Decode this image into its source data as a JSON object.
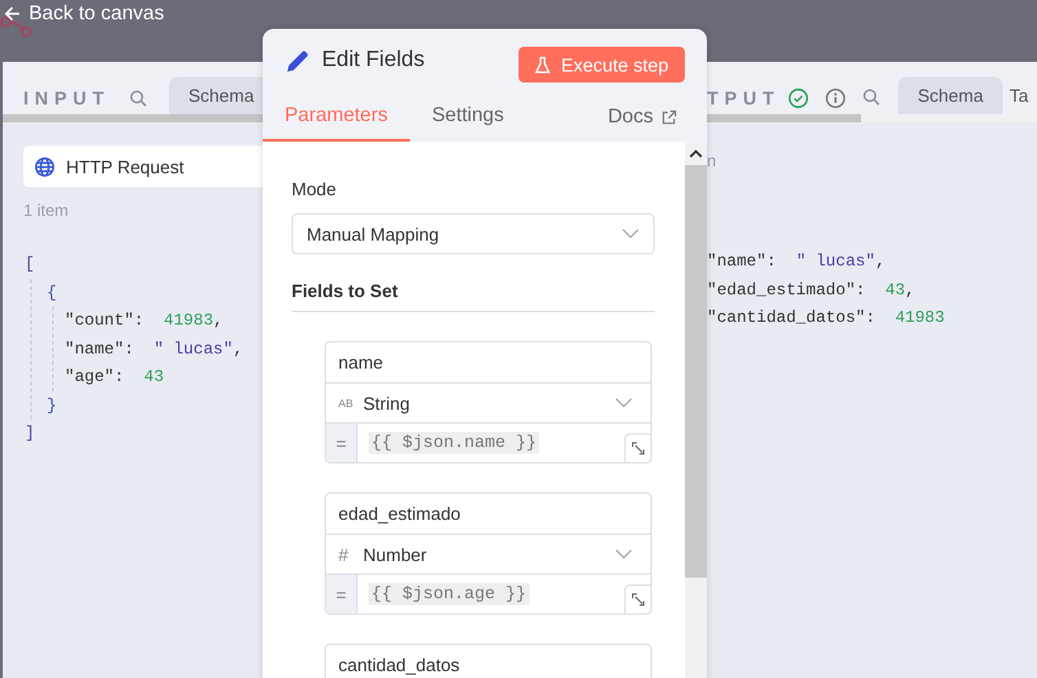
{
  "top_bar": {
    "back_label": "Back to canvas"
  },
  "input_panel": {
    "title": "INPUT",
    "view_tab": "Schema",
    "node_selector": "HTTP Request",
    "item_count": "1 item",
    "json": {
      "open": "[",
      "close": "]",
      "children": [
        {
          "open": "{",
          "close": "}",
          "fields": [
            {
              "key": "\"count\":",
              "value": "41983",
              "kind": "number",
              "comma": ","
            },
            {
              "key": "\"name\":",
              "value": "\" lucas\"",
              "kind": "string",
              "comma": ","
            },
            {
              "key": "\"age\":",
              "value": "43",
              "kind": "number"
            }
          ]
        }
      ]
    }
  },
  "output_panel": {
    "title": "TPUT",
    "success": true,
    "view_tabs": [
      "Schema",
      "Ta"
    ],
    "item_count": "n",
    "fields": [
      {
        "key": "\"name\":",
        "value": "\" lucas\"",
        "kind": "string",
        "comma": ","
      },
      {
        "key": "\"edad_estimado\":",
        "value": "43",
        "kind": "number",
        "comma": ","
      },
      {
        "key": "\"cantidad_datos\":",
        "value": "41983",
        "kind": "number"
      }
    ]
  },
  "editor": {
    "title": "Edit Fields",
    "execute_label": "Execute step",
    "tabs": [
      {
        "label": "Parameters",
        "selected": true
      },
      {
        "label": "Settings",
        "selected": false
      }
    ],
    "docs_label": "Docs",
    "mode_label": "Mode",
    "mode_value": "Manual Mapping",
    "section_label": "Fields to Set",
    "fields": [
      {
        "name": "name",
        "type_icon": "AB",
        "type": "String",
        "expression_mark": "=",
        "value": "{{ $json.name }}"
      },
      {
        "name": "edad_estimado",
        "type_icon": "#",
        "type": "Number",
        "expression_mark": "=",
        "value": "{{ $json.age }}"
      },
      {
        "name": "cantidad_datos"
      }
    ]
  }
}
